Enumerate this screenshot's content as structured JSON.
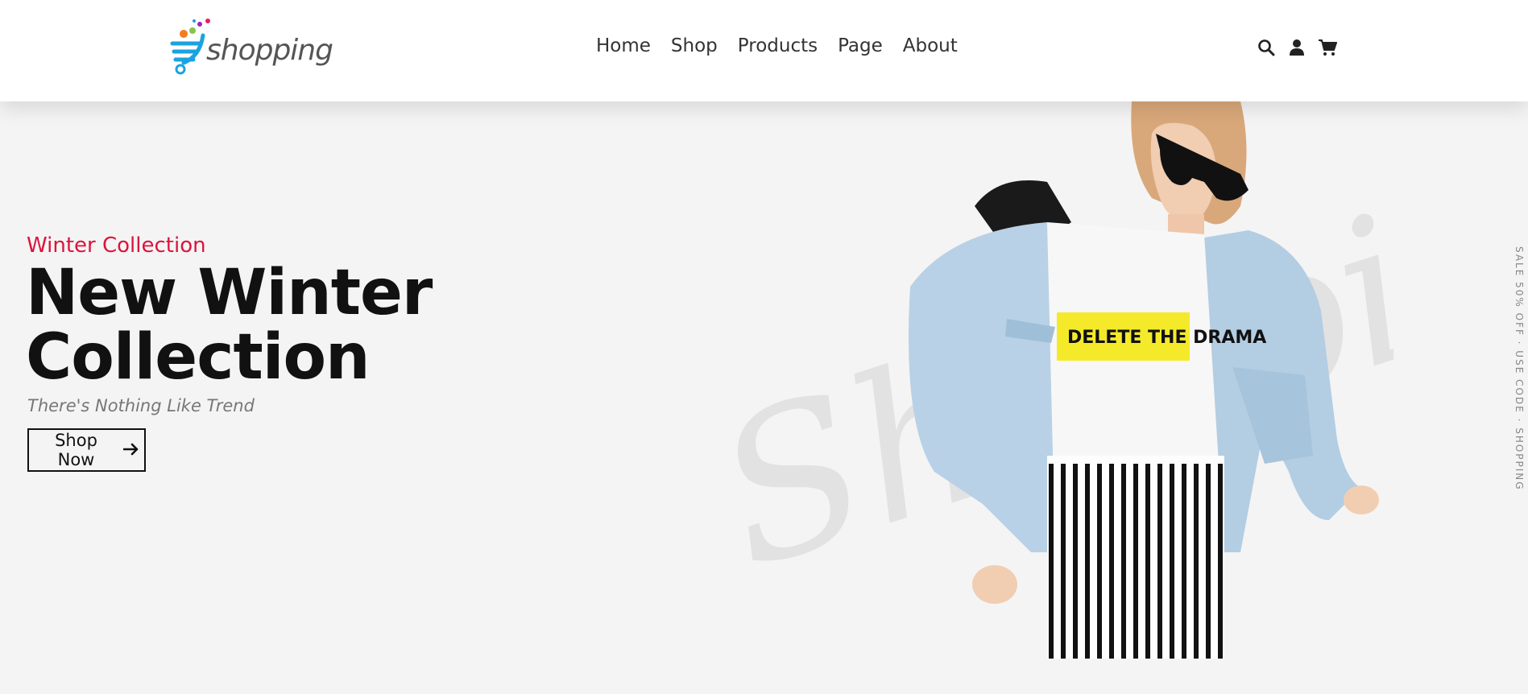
{
  "header": {
    "logo_text": "shopping",
    "nav": [
      "Home",
      "Shop",
      "Products",
      "Page",
      "About"
    ],
    "icons": [
      "search-icon",
      "user-icon",
      "cart-icon"
    ]
  },
  "hero": {
    "tagline": "Winter Collection",
    "title": "New Winter Collection",
    "subtitle": "There's Nothing Like Trend",
    "button_label": "Shop Now",
    "watermark": "Shopping",
    "shirt_text": "DELETE THE DRAMA",
    "side_text": "SALE 50% OFF · USE CODE · SHOPPING",
    "accent_color": "#dc143c",
    "background_color": "#f4f4f4"
  }
}
